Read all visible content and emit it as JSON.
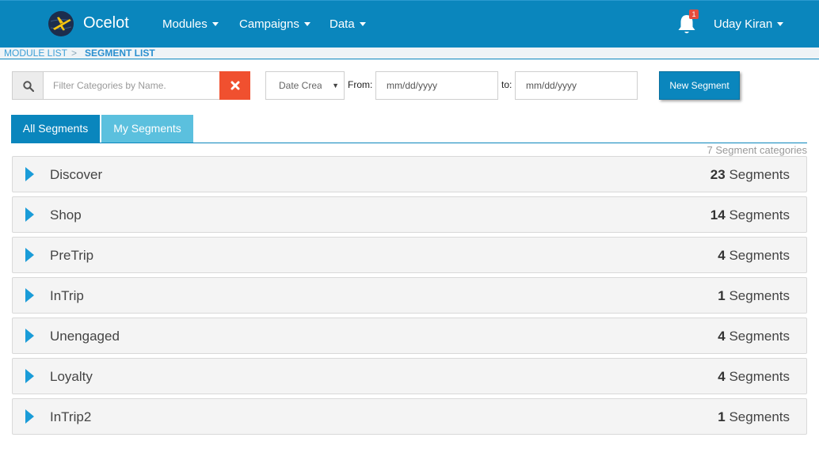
{
  "header": {
    "brand": "Ocelot",
    "nav": [
      "Modules",
      "Campaigns",
      "Data"
    ],
    "notifications_count": "1",
    "user_name": "Uday Kiran"
  },
  "breadcrumb": {
    "items": [
      "MODULE LIST",
      "SEGMENT LIST"
    ],
    "separator": ">"
  },
  "filters": {
    "search_placeholder": "Filter Categories by Name.",
    "sort_selected": "Date Created",
    "from_label": "From:",
    "to_label": "to:",
    "from_placeholder": "mm/dd/yyyy",
    "to_placeholder": "mm/dd/yyyy",
    "new_segment_label": "New Segment"
  },
  "tabs": [
    "All Segments",
    "My Segments"
  ],
  "category_count_label": "7 Segment categories",
  "categories": [
    {
      "name": "Discover",
      "count": "23",
      "unit": "Segments"
    },
    {
      "name": "Shop",
      "count": "14",
      "unit": "Segments"
    },
    {
      "name": "PreTrip",
      "count": "4",
      "unit": "Segments"
    },
    {
      "name": "InTrip",
      "count": "1",
      "unit": "Segments"
    },
    {
      "name": "Unengaged",
      "count": "4",
      "unit": "Segments"
    },
    {
      "name": "Loyalty",
      "count": "4",
      "unit": "Segments"
    },
    {
      "name": "InTrip2",
      "count": "1",
      "unit": "Segments"
    }
  ],
  "colors": {
    "primary": "#0a86bd",
    "tab_inactive": "#5bc0de",
    "danger": "#f0502f",
    "arrow": "#1a9cd8",
    "badge": "#e74c3c"
  },
  "icons": {
    "logo": "globe-plane-logo",
    "notifications": "bell-icon",
    "search": "search-icon",
    "clear": "close-icon",
    "expand": "caret-right-icon"
  }
}
